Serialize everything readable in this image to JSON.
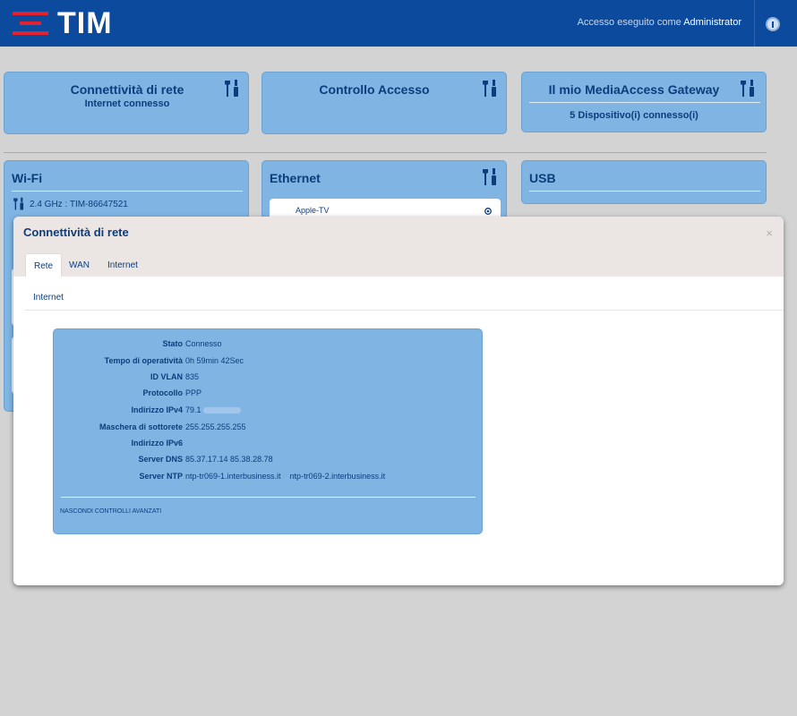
{
  "header": {
    "brand": "TIM",
    "login_prefix": "Accesso eseguito come",
    "login_user": "Administrator"
  },
  "cards": {
    "connettivita": {
      "title": "Connettività di rete",
      "subtitle": "Internet connesso"
    },
    "controllo": {
      "title": "Controllo Accesso"
    },
    "gateway": {
      "title": "Il mio MediaAccess Gateway",
      "subtitle": "5 Dispositivo(i) connesso(i)"
    },
    "wifi": {
      "title": "Wi-Fi",
      "row1": "2.4 GHz : TIM-86647521"
    },
    "ethernet": {
      "title": "Ethernet",
      "device": "Apple-TV"
    },
    "usb": {
      "title": "USB"
    }
  },
  "modal": {
    "title": "Connettività di rete",
    "close": "×",
    "tabs": [
      "Rete",
      "WAN",
      "Internet"
    ],
    "section": "Internet",
    "rows": [
      {
        "label": "Stato",
        "value": "Connesso"
      },
      {
        "label": "Tempo di operatività",
        "value": "0h 59min 42Sec"
      },
      {
        "label": "ID VLAN",
        "value": "835"
      },
      {
        "label": "Protocollo",
        "value": "PPP"
      },
      {
        "label": "Indirizzo IPv4",
        "value": "79.1"
      },
      {
        "label": "Maschera di sottorete",
        "value": "255.255.255.255"
      },
      {
        "label": "Indirizzo IPv6",
        "value": ""
      },
      {
        "label": "Server DNS",
        "value": "85.37.17.14 85.38.28.78"
      },
      {
        "label": "Server NTP",
        "value": "ntp-tr069-1.interbusiness.it    ntp-tr069-2.interbusiness.it"
      }
    ],
    "advanced_link": "NASCONDI CONTROLLI AVANZATI"
  },
  "colors": {
    "header_bg": "#0b4a9c",
    "logo_red": "#e2232f",
    "card_bg": "#7fb4e3",
    "text_dark": "#0d3d7c",
    "modal_header_bg": "#ebe6e3"
  },
  "icons": [
    "power-icon",
    "tools-icon",
    "close-icon",
    "circle-arrow-icon"
  ]
}
